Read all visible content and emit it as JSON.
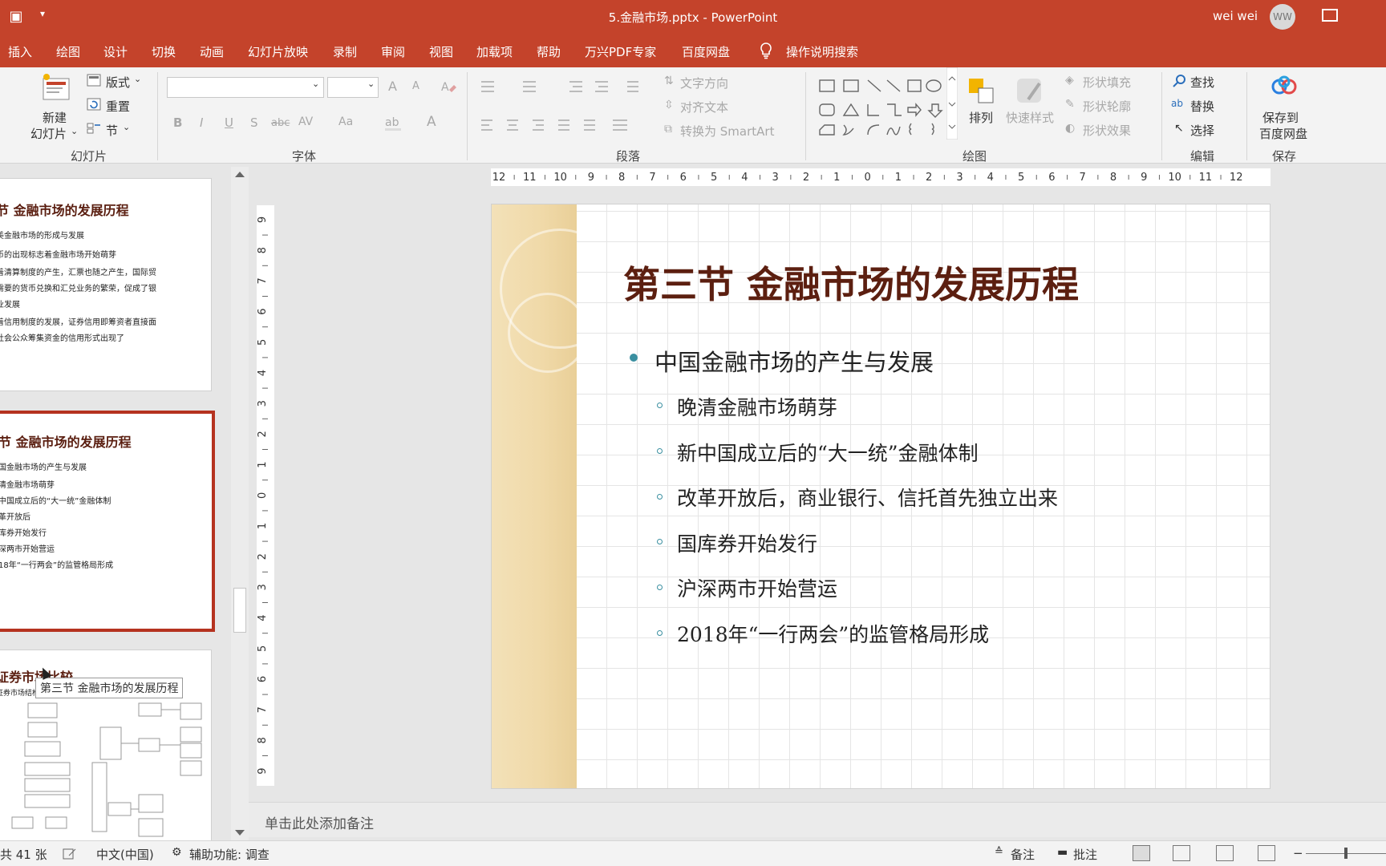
{
  "titlebar": {
    "doc_title": "5.金融市场.pptx  -  PowerPoint",
    "user_name": "wei wei",
    "avatar_initials": "WW"
  },
  "menu": {
    "tabs": [
      "插入",
      "绘图",
      "设计",
      "切换",
      "动画",
      "幻灯片放映",
      "录制",
      "审阅",
      "视图",
      "加载项",
      "帮助",
      "万兴PDF专家",
      "百度网盘"
    ],
    "search_label": "操作说明搜索"
  },
  "ribbon": {
    "slides": {
      "new_slide_line1": "新建",
      "new_slide_line2": "幻灯片",
      "layout": "版式",
      "reset": "重置",
      "section": "节",
      "label": "幻灯片"
    },
    "font": {
      "label": "字体",
      "bold": "B",
      "italic": "I",
      "underline": "U",
      "shadow": "S",
      "strike": "abc",
      "spacing": "AV",
      "case": "Aa",
      "color": "A",
      "grow": "A",
      "shrink": "A"
    },
    "paragraph": {
      "label": "段落",
      "text_direction": "文字方向",
      "align_text": "对齐文本",
      "convert_smartart": "转换为 SmartArt"
    },
    "drawing": {
      "label": "绘图",
      "arrange": "排列",
      "quick_styles": "快速样式",
      "shape_fill": "形状填充",
      "shape_outline": "形状轮廓",
      "shape_effects": "形状效果"
    },
    "editing": {
      "label": "编辑",
      "find": "查找",
      "replace": "替换",
      "select": "选择"
    },
    "save": {
      "label": "保存",
      "save_to_line1": "保存到",
      "save_to_line2": "百度网盘"
    }
  },
  "thumbnails": [
    {
      "title": "节 金融市场的发展历程",
      "lines": [
        "美金融市场的形成与发展",
        "币的出现标志着金融市场开始萌芽",
        "着清算制度的产生，汇票也随之产生，国际贸",
        "需要的货币兑换和汇兑业务的繁荣，促成了银",
        "业发展",
        "着信用制度的发展，证券信用即筹资者直接面",
        "社会公众筹集资金的信用形式出现了"
      ]
    },
    {
      "title": "节 金融市场的发展历程",
      "lines": [
        "国金融市场的产生与发展",
        "清金融市场萌芽",
        "中国成立后的“大一统”金融体制",
        "革开放后",
        "库券开始发行",
        "深两市开始营运",
        "18年“一行两会”的监管格局形成"
      ]
    },
    {
      "title": "证券市场比较",
      "lines": [
        "证券市场结构"
      ]
    }
  ],
  "tooltip": "第三节 金融市场的发展历程",
  "hruler_labels": [
    "12",
    "11",
    "10",
    "9",
    "8",
    "7",
    "6",
    "5",
    "4",
    "3",
    "2",
    "1",
    "0",
    "1",
    "2",
    "3",
    "4",
    "5",
    "6",
    "7",
    "8",
    "9",
    "10",
    "11",
    "12"
  ],
  "vruler_labels": [
    "9",
    "8",
    "7",
    "6",
    "5",
    "4",
    "3",
    "2",
    "1",
    "0",
    "1",
    "2",
    "3",
    "4",
    "5",
    "6",
    "7",
    "8",
    "9"
  ],
  "slide": {
    "title": "第三节 金融市场的发展历程",
    "level1": "中国金融市场的产生与发展",
    "level2": [
      "晚清金融市场萌芽",
      "新中国成立后的“大一统”金融体制",
      "改革开放后，商业银行、信托首先独立出来",
      "国库券开始发行",
      "沪深两市开始营运",
      "2018年“一行两会”的监管格局形成"
    ]
  },
  "notes": {
    "placeholder": "单击此处添加备注"
  },
  "status": {
    "slide_count": "共 41 张",
    "language": "中文(中国)",
    "accessibility": "辅助功能: 调查",
    "notes_button": "备注",
    "comments_button": "批注"
  },
  "colors": {
    "accent": "#c4432b",
    "title_text": "#5c1f10",
    "bullet": "#3a8fa0",
    "band": "#f0d9a8"
  }
}
